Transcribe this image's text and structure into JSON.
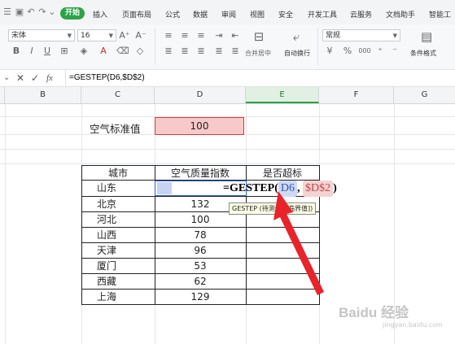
{
  "menubar": {
    "start_tab": "开始",
    "tabs": [
      "插入",
      "页面布局",
      "公式",
      "数据",
      "审阅",
      "视图",
      "安全",
      "开发工具",
      "云服务",
      "文档助手",
      "智能工"
    ]
  },
  "ribbon": {
    "font_name": "宋体",
    "font_size": "16",
    "merge_label": "合并居中",
    "wrap_label": "自动换行",
    "number_format": "常规",
    "cond_format_label": "条件格式",
    "bold": "B",
    "italic": "I",
    "underline": "U",
    "font_color": "A",
    "percent": "%",
    "thousands": "000"
  },
  "formula_bar": {
    "content": "=GESTEP(D6,$D$2)",
    "fx": "fx"
  },
  "columns": [
    "B",
    "C",
    "D",
    "E",
    "F",
    "G"
  ],
  "active_column": "E",
  "sheet": {
    "std_label": "空气标准值",
    "std_value": "100",
    "headers": [
      "城市",
      "空气质量指数",
      "是否超标"
    ],
    "rows": [
      {
        "city": "山东",
        "value": ""
      },
      {
        "city": "北京",
        "value": "132"
      },
      {
        "city": "河北",
        "value": "100"
      },
      {
        "city": "山西",
        "value": "78"
      },
      {
        "city": "天津",
        "value": "96"
      },
      {
        "city": "厦门",
        "value": "53"
      },
      {
        "city": "西藏",
        "value": "62"
      },
      {
        "city": "上海",
        "value": "129"
      }
    ]
  },
  "editing": {
    "prefix": "=GESTEP(",
    "arg1": "D6",
    "sep": ",",
    "arg2": "$D$2",
    "suffix": ")",
    "tooltip": "GESTEP (待测值, [临界值])"
  },
  "colors": {
    "accent": "#2ba346",
    "arrow": "#e8232a",
    "ref1": "#2f57b8",
    "ref2": "#c24848"
  },
  "watermark": {
    "brand": "Baidu 经验",
    "sub": "jingyan.baidu.com"
  }
}
